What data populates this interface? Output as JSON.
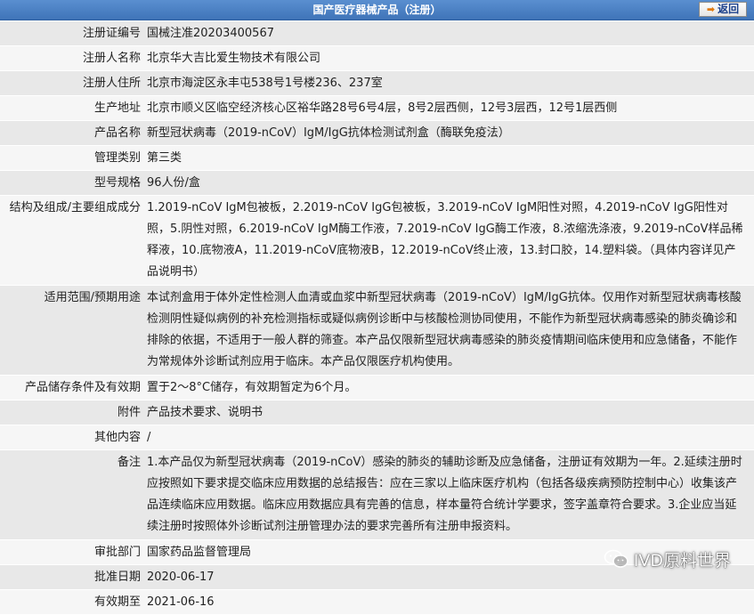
{
  "header": {
    "title": "国产医疗器械产品（注册）",
    "back_label": "返回"
  },
  "rows": [
    {
      "label": "注册证编号",
      "value": "国械注准20203400567"
    },
    {
      "label": "注册人名称",
      "value": "北京华大吉比爱生物技术有限公司"
    },
    {
      "label": "注册人住所",
      "value": "北京市海淀区永丰屯538号1号楼236、237室"
    },
    {
      "label": "生产地址",
      "value": "北京市顺义区临空经济核心区裕华路28号6号4层，8号2层西侧，12号3层西，12号1层西侧"
    },
    {
      "label": "产品名称",
      "value": "新型冠状病毒（2019-nCoV）IgM/IgG抗体检测试剂盒（酶联免疫法）"
    },
    {
      "label": "管理类别",
      "value": "第三类"
    },
    {
      "label": "型号规格",
      "value": "96人份/盒"
    },
    {
      "label": "结构及组成/主要组成成分",
      "value": "1.2019-nCoV IgM包被板，2.2019-nCoV IgG包被板，3.2019-nCoV IgM阳性对照，4.2019-nCoV IgG阳性对照，5.阴性对照，6.2019-nCoV IgM酶工作液，7.2019-nCoV IgG酶工作液，8.浓缩洗涤液，9.2019-nCoV样品稀释液，10.底物液A，11.2019-nCoV底物液B，12.2019-nCoV终止液，13.封口胶，14.塑料袋。（具体内容详见产品说明书）"
    },
    {
      "label": "适用范围/预期用途",
      "value": "本试剂盒用于体外定性检测人血清或血浆中新型冠状病毒（2019-nCoV）IgM/IgG抗体。仅用作对新型冠状病毒核酸检测阴性疑似病例的补充检测指标或疑似病例诊断中与核酸检测协同使用，不能作为新型冠状病毒感染的肺炎确诊和排除的依据，不适用于一般人群的筛查。本产品仅限新型冠状病毒感染的肺炎疫情期间临床使用和应急储备，不能作为常规体外诊断试剂应用于临床。本产品仅限医疗机构使用。"
    },
    {
      "label": "产品储存条件及有效期",
      "value": "置于2～8°C储存，有效期暂定为6个月。"
    },
    {
      "label": "附件",
      "value": "产品技术要求、说明书"
    },
    {
      "label": "其他内容",
      "value": "/"
    },
    {
      "label": "备注",
      "value": "1.本产品仅为新型冠状病毒（2019-nCoV）感染的肺炎的辅助诊断及应急储备，注册证有效期为一年。2.延续注册时应按照如下要求提交临床应用数据的总结报告：应在三家以上临床医疗机构（包括各级疾病预防控制中心）收集该产品连续临床应用数据。临床应用数据应具有完善的信息，样本量符合统计学要求，签字盖章符合要求。3.企业应当延续注册时按照体外诊断试剂注册管理办法的要求完善所有注册申报资料。"
    },
    {
      "label": "审批部门",
      "value": "国家药品监督管理局"
    },
    {
      "label": "批准日期",
      "value": "2020-06-17"
    },
    {
      "label": "有效期至",
      "value": "2021-06-16"
    }
  ],
  "watermark": {
    "text": "IVD原料世界",
    "icon": "wechat-icon"
  },
  "colors": {
    "header": "#4a7fc1",
    "row_odd": "#e8e8e8",
    "row_even": "#f6f6f6",
    "button_text": "#1a3f8a",
    "arrow": "#e07a10"
  }
}
